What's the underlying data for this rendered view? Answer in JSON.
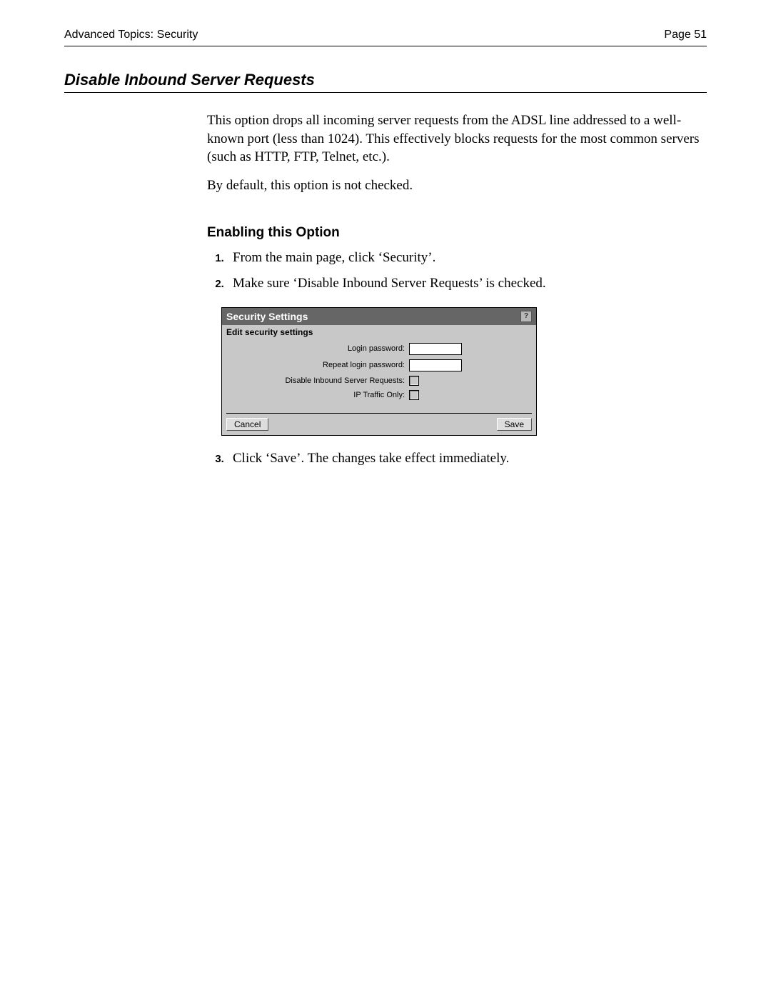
{
  "header": {
    "left": "Advanced Topics: Security",
    "right": "Page 51"
  },
  "section_title": "Disable Inbound Server Requests",
  "body": {
    "p1": "This option drops all incoming server requests from the ADSL line addressed to a well-known port (less than 1024). This effectively blocks requests for the most common servers (such as HTTP, FTP, Telnet, etc.).",
    "p2": "By default, this option is not checked."
  },
  "subheading": "Enabling this Option",
  "steps": {
    "s1": "From the main page, click ‘Security’.",
    "s2": "Make sure ‘Disable Inbound Server Requests’ is checked.",
    "s3": "Click ‘Save’. The changes take effect immediately."
  },
  "panel": {
    "title": "Security Settings",
    "help_glyph": "?",
    "subtitle": "Edit security settings",
    "rows": {
      "login_password": "Login password:",
      "repeat_password": "Repeat login password:",
      "disable_inbound": "Disable Inbound Server Requests:",
      "ip_only": "IP Traffic Only:"
    },
    "buttons": {
      "cancel": "Cancel",
      "save": "Save"
    }
  }
}
